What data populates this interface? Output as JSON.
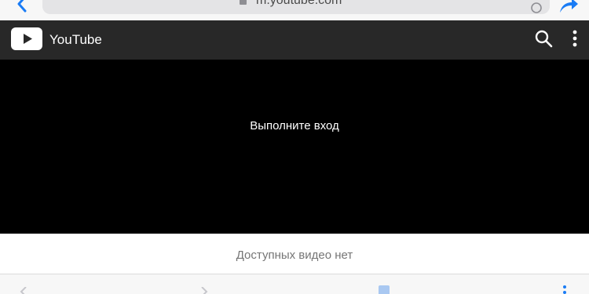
{
  "browser": {
    "url": "m.youtube.com",
    "accent_color": "#1a7cf5"
  },
  "header": {
    "title": "YouTube",
    "background_color": "#282828"
  },
  "player": {
    "message": "Выполните вход"
  },
  "video_list": {
    "empty_message": "Доступных видео нет"
  },
  "icons": {
    "back": "chevron-left-icon",
    "lock": "lock-icon",
    "reload": "reload-icon",
    "share": "share-arrow-icon",
    "logo": "youtube-play-icon",
    "search": "search-icon",
    "more": "vertical-dots-icon"
  }
}
